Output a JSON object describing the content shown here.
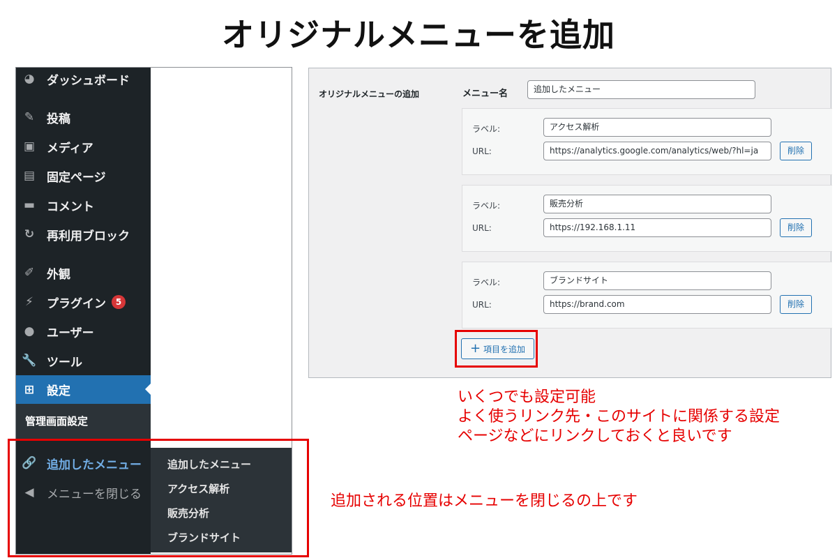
{
  "title": "オリジナルメニューを追加",
  "sidebar": {
    "items": [
      {
        "label": "ダッシュボード",
        "icon": "dashboard-icon"
      },
      {
        "label": "投稿",
        "icon": "pin-icon"
      },
      {
        "label": "メディア",
        "icon": "media-icon"
      },
      {
        "label": "固定ページ",
        "icon": "page-icon"
      },
      {
        "label": "コメント",
        "icon": "comment-icon"
      },
      {
        "label": "再利用ブロック",
        "icon": "reuse-icon"
      },
      {
        "label": "外観",
        "icon": "brush-icon"
      },
      {
        "label": "プラグイン",
        "icon": "plugin-icon",
        "badge": "5"
      },
      {
        "label": "ユーザー",
        "icon": "user-icon"
      },
      {
        "label": "ツール",
        "icon": "wrench-icon"
      },
      {
        "label": "設定",
        "icon": "settings-icon"
      }
    ],
    "submenu_current": "管理画面設定",
    "added_menu": "追加したメニュー",
    "collapse": "メニューを閉じる"
  },
  "flyout": {
    "items": [
      "追加したメニュー",
      "アクセス解析",
      "販売分析",
      "ブランドサイト"
    ]
  },
  "settings": {
    "heading": "オリジナルメニューの追加",
    "menu_name_label": "メニュー名",
    "menu_name_value": "追加したメニュー",
    "label_text": "ラベル:",
    "url_text": "URL:",
    "delete_label": "削除",
    "items": [
      {
        "label": "アクセス解析",
        "url": "https://analytics.google.com/analytics/web/?hl=ja"
      },
      {
        "label": "販売分析",
        "url": "https://192.168.1.11"
      },
      {
        "label": "ブランドサイト",
        "url": "https://brand.com"
      }
    ],
    "add_button": "項目を追加"
  },
  "notes": {
    "right_lines": [
      "いくつでも設定可能",
      "よく使うリンク先・このサイトに関係する設定",
      "ページなどにリンクしておくと良いです"
    ],
    "bottom": "追加される位置はメニューを閉じるの上です"
  },
  "colors": {
    "sidebar_bg": "#1d2327",
    "accent": "#2271b1",
    "annotation_red": "#e60000",
    "badge_red": "#d63638"
  }
}
